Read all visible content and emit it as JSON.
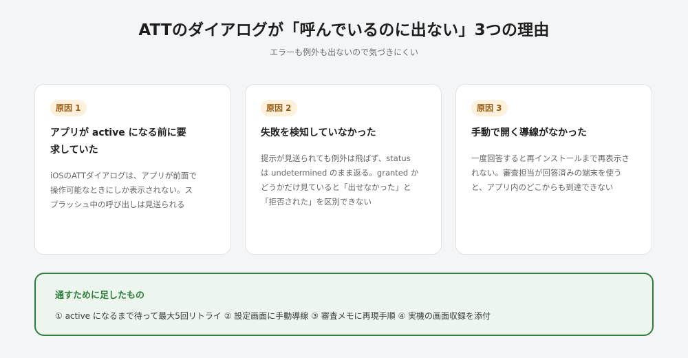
{
  "header": {
    "title": "ATTのダイアログが「呼んでいるのに出ない」3つの理由",
    "subtitle": "エラーも例外も出ないので気づきにくい"
  },
  "cards": [
    {
      "badge": "原因 1",
      "title": "アプリが active になる前に要求していた",
      "text": "iOSのATTダイアログは、アプリが前面で操作可能なときにしか表示されない。スプラッシュ中の呼び出しは見送られる"
    },
    {
      "badge": "原因 2",
      "title": "失敗を検知していなかった",
      "text": "提示が見送られても例外は飛ばず、status は undetermined のまま返る。granted かどうかだけ見ていると「出せなかった」と「拒否された」を区別できない"
    },
    {
      "badge": "原因 3",
      "title": "手動で開く導線がなかった",
      "text": "一度回答すると再インストールまで再表示されない。審査担当が回答済みの端末を使うと、アプリ内のどこからも到達できない"
    }
  ],
  "summary": {
    "title": "通すために足したもの",
    "text": "① active になるまで待って最大5回リトライ ② 設定画面に手動導線 ③ 審査メモに再現手順 ④ 実機の画面収録を添付"
  },
  "colors": {
    "background": "#f4f5f7",
    "badge_bg": "#fdf1dc",
    "badge_text": "#9a5b10",
    "summary_border": "#2e7d3a",
    "summary_bg": "#edf6ee"
  }
}
